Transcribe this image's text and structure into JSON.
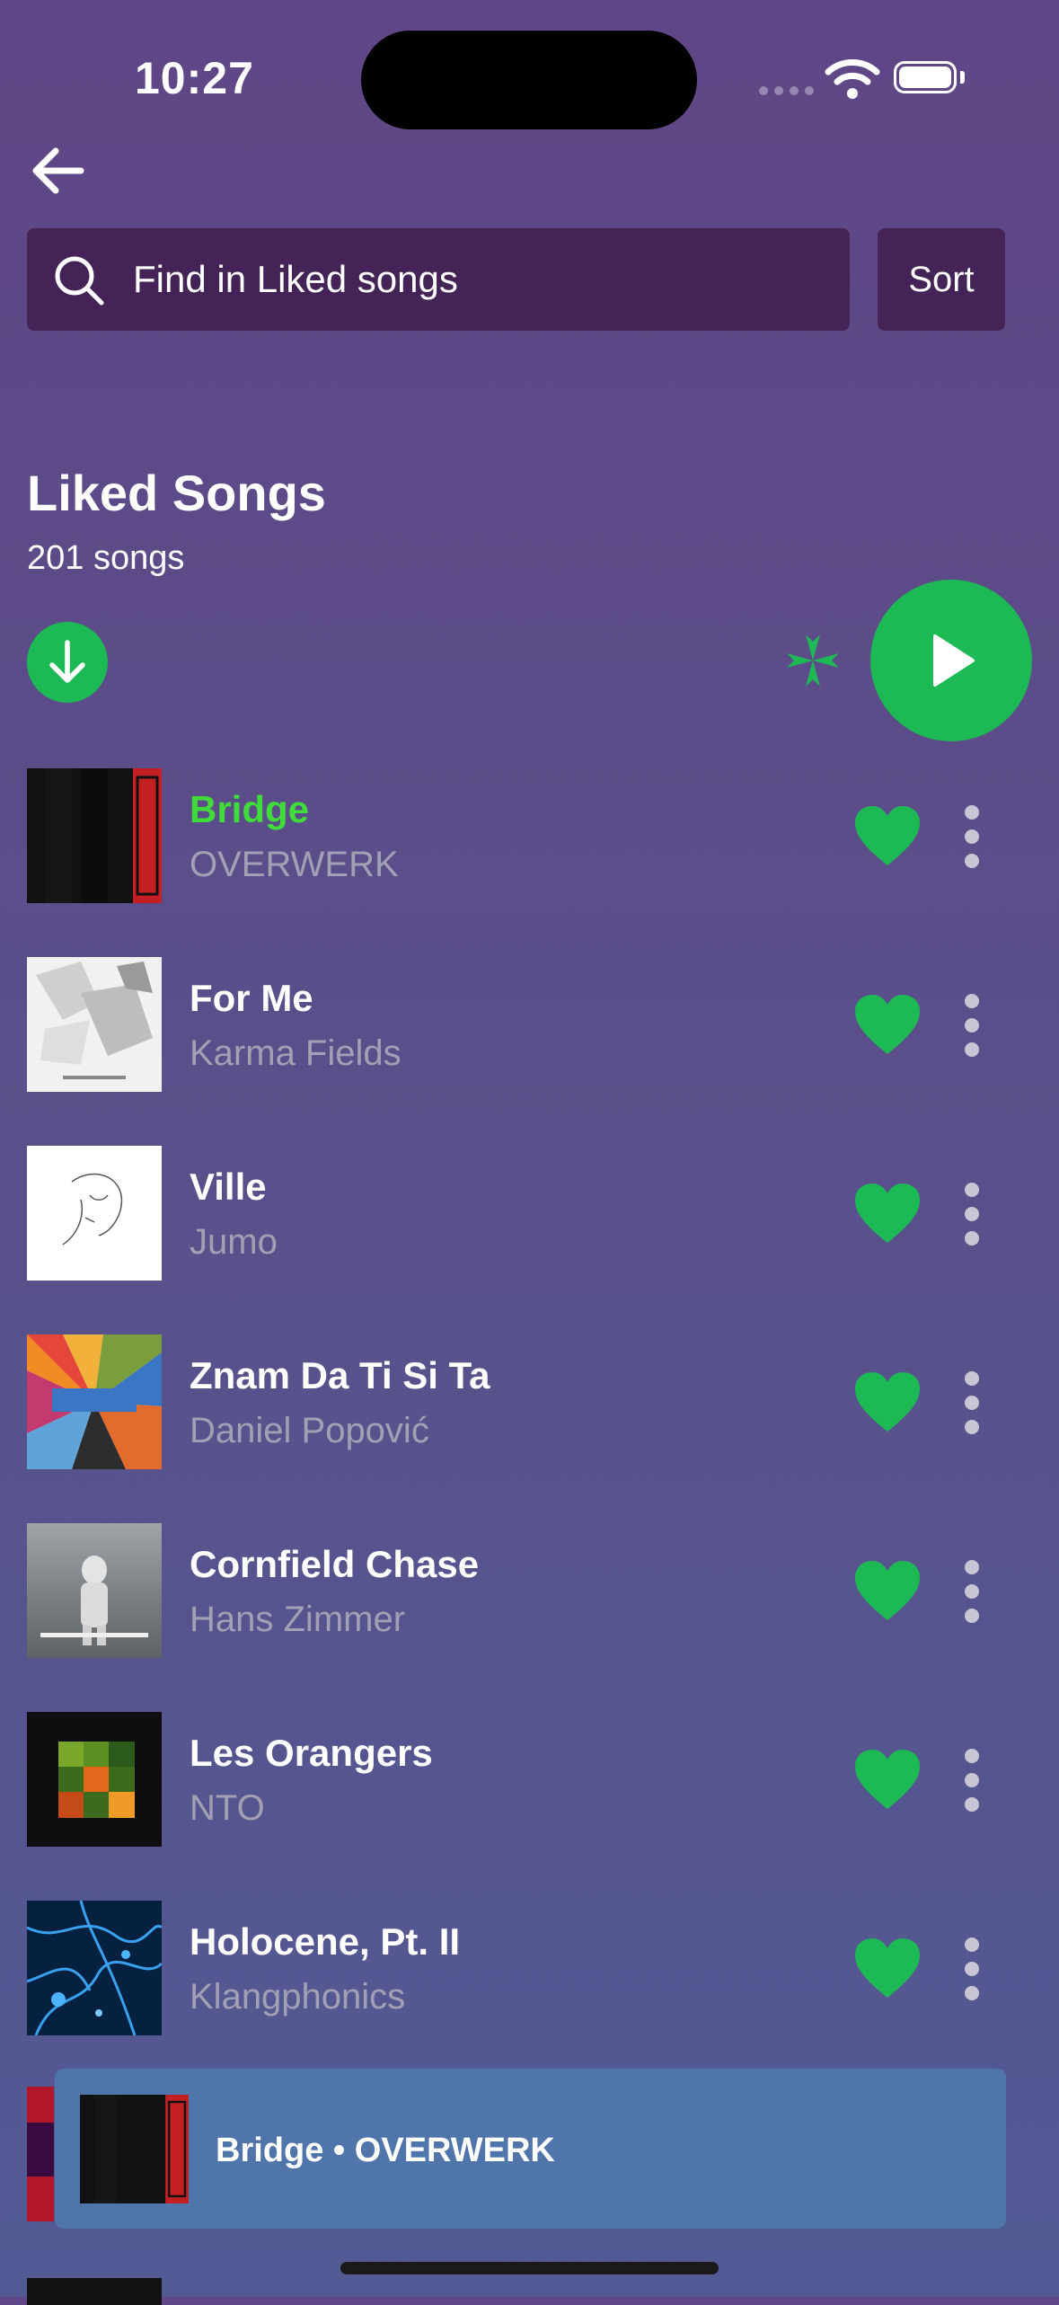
{
  "status_bar": {
    "time": "10:27"
  },
  "search": {
    "placeholder": "Find in Liked songs",
    "sort_label": "Sort"
  },
  "header": {
    "title": "Liked Songs",
    "count": "201 songs"
  },
  "colors": {
    "accent": "#1db954",
    "active_track": "#3fdc3a",
    "search_bg": "#442456",
    "mini_player_bg": "#5075ab"
  },
  "songs": [
    {
      "title": "Bridge",
      "artist": "OVERWERK",
      "active": true,
      "liked": true
    },
    {
      "title": "For Me",
      "artist": "Karma Fields",
      "liked": true
    },
    {
      "title": "Ville",
      "artist": "Jumo",
      "liked": true
    },
    {
      "title": "Znam Da Ti Si Ta",
      "artist": "Daniel Popović",
      "liked": true
    },
    {
      "title": "Cornfield Chase",
      "artist": "Hans Zimmer",
      "liked": true
    },
    {
      "title": "Les Orangers",
      "artist": "NTO",
      "liked": true
    },
    {
      "title": "Holocene, Pt. II",
      "artist": "Klangphonics",
      "liked": true
    }
  ],
  "now_playing": {
    "text": "Bridge • OVERWERK"
  },
  "icons": [
    "back-arrow-icon",
    "search-icon",
    "download-icon",
    "shuffle-icon",
    "play-icon",
    "heart-icon",
    "more-vertical-icon"
  ]
}
